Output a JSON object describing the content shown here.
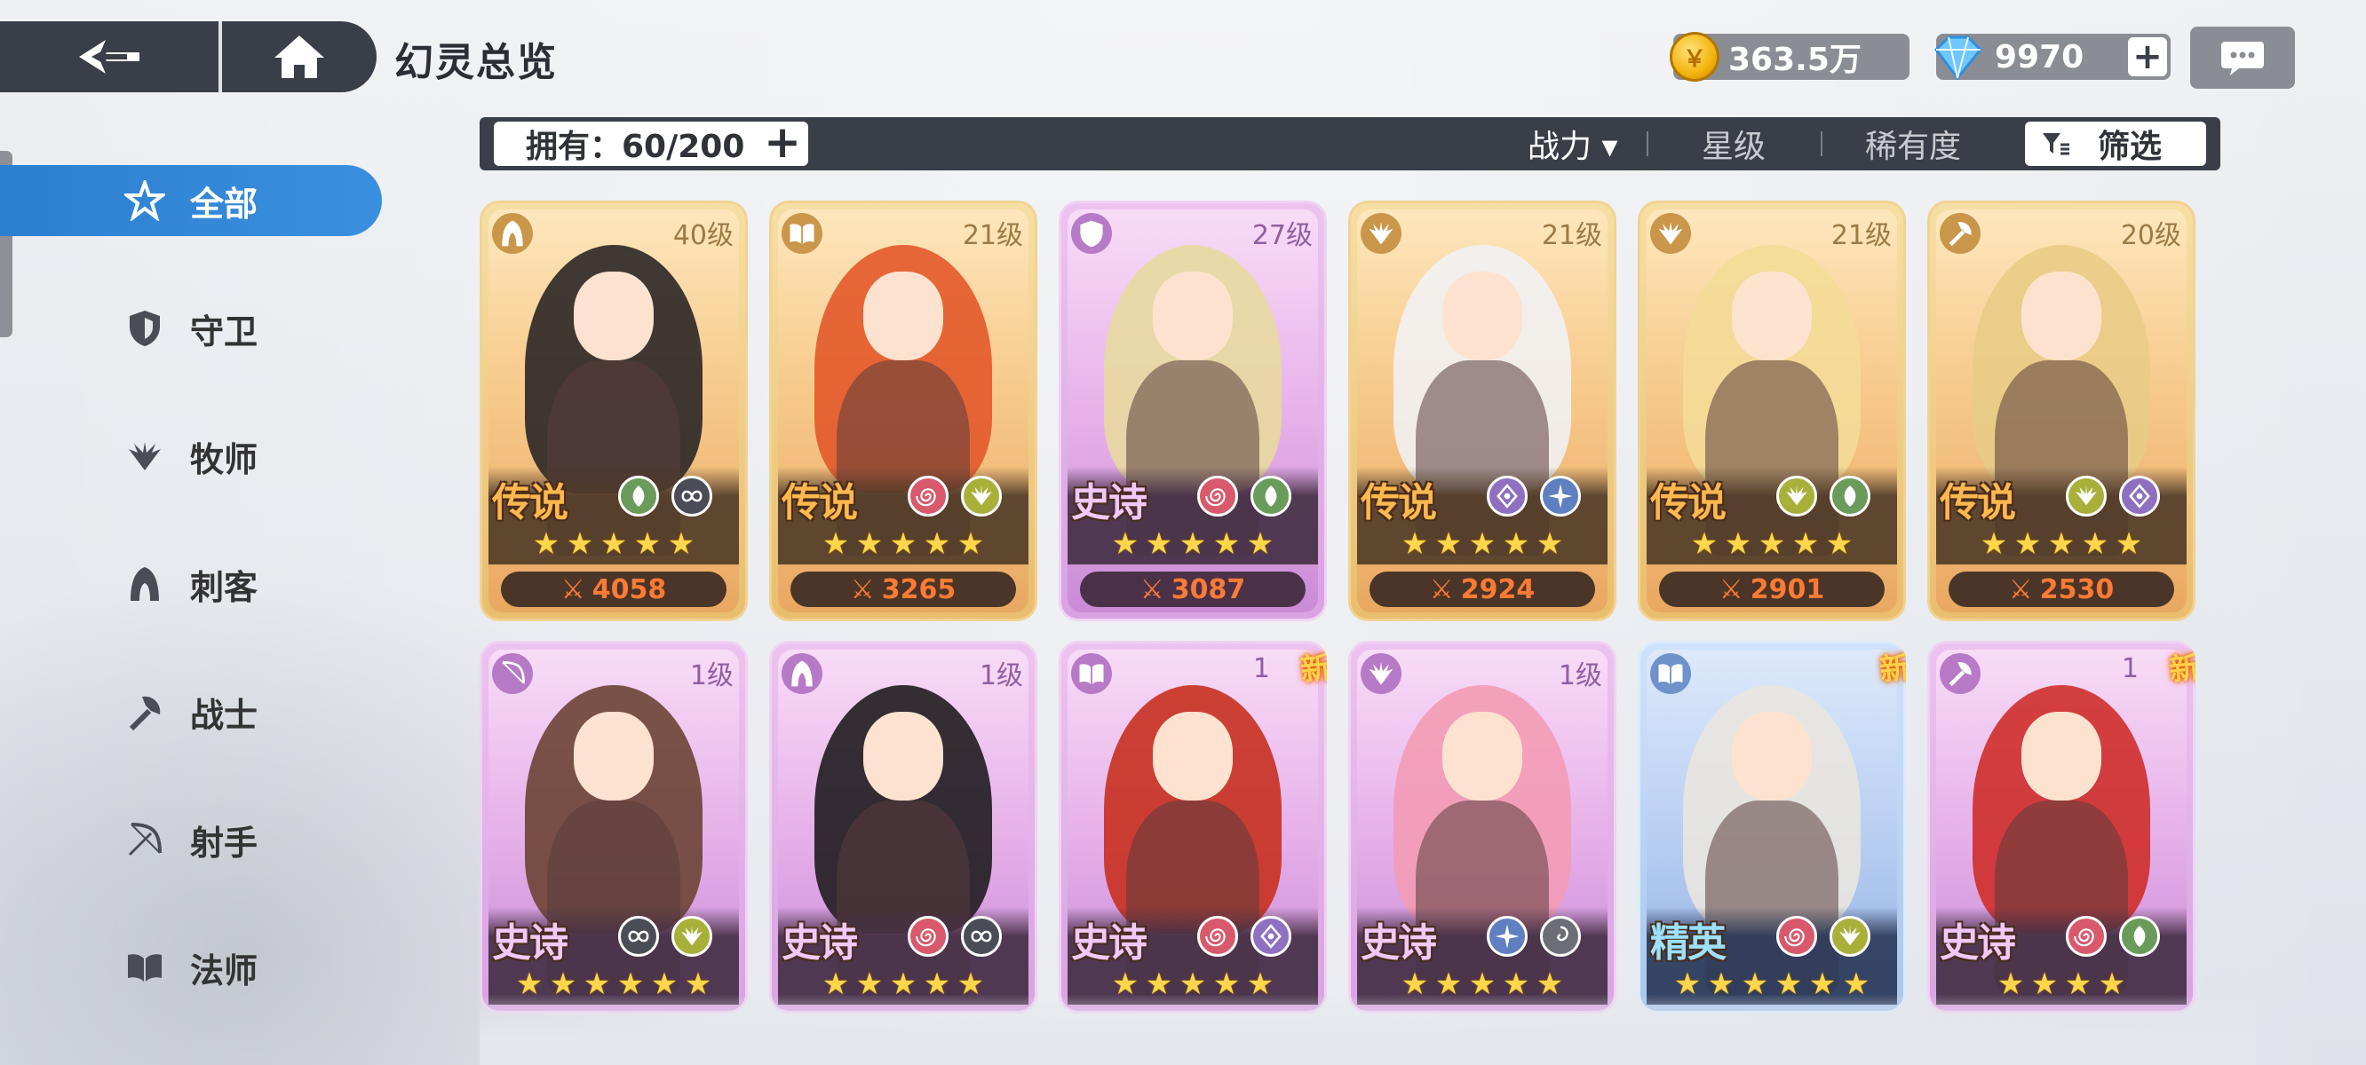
{
  "header": {
    "title": "幻灵总览"
  },
  "resources": {
    "gold": "363.5万",
    "gems": "9970"
  },
  "sidebar": {
    "items": [
      {
        "label": "全部",
        "icon": "all-star-icon",
        "active": true
      },
      {
        "label": "守卫",
        "icon": "shield-icon"
      },
      {
        "label": "牧师",
        "icon": "wings-icon"
      },
      {
        "label": "刺客",
        "icon": "hood-icon"
      },
      {
        "label": "战士",
        "icon": "axe-icon"
      },
      {
        "label": "射手",
        "icon": "bow-icon"
      },
      {
        "label": "法师",
        "icon": "book-icon"
      }
    ]
  },
  "filter": {
    "owned": "拥有：60/200",
    "sort_power": "战力 ▾",
    "sort_star": "星级",
    "sort_rarity": "稀有度",
    "filter_label": "筛选"
  },
  "cards": [
    {
      "level": "40级",
      "rarity": "传说",
      "stars": 5,
      "power": "4058",
      "class_icon": "hood-icon",
      "elements": [
        "leaf-icon",
        "infinity-icon"
      ],
      "theme": "legend",
      "hair": "#2b2626",
      "new": false
    },
    {
      "level": "21级",
      "rarity": "传说",
      "stars": 5,
      "power": "3265",
      "class_icon": "book-icon",
      "elements": [
        "spiral-icon",
        "wings-icon"
      ],
      "theme": "legend",
      "hair": "#e3592a",
      "new": false
    },
    {
      "level": "27级",
      "rarity": "史诗",
      "stars": 5,
      "power": "3087",
      "class_icon": "shield-icon",
      "elements": [
        "spiral-icon",
        "leaf-icon"
      ],
      "theme": "epic",
      "hair": "#e8d9a0",
      "new": false
    },
    {
      "level": "21级",
      "rarity": "传说",
      "stars": 5,
      "power": "2924",
      "class_icon": "wings-icon",
      "elements": [
        "diamond-icon",
        "sparkle-icon"
      ],
      "theme": "legend",
      "hair": "#f1f1f3",
      "new": false
    },
    {
      "level": "21级",
      "rarity": "传说",
      "stars": 5,
      "power": "2901",
      "class_icon": "wings-icon",
      "elements": [
        "wings-icon",
        "leaf-icon"
      ],
      "theme": "legend",
      "hair": "#f3dc97",
      "new": false
    },
    {
      "level": "20级",
      "rarity": "传说",
      "stars": 5,
      "power": "2530",
      "class_icon": "axe-icon",
      "elements": [
        "wings-icon",
        "diamond-icon"
      ],
      "theme": "legend",
      "hair": "#e8cc86",
      "new": false
    },
    {
      "level": "1级",
      "rarity": "史诗",
      "stars": 6,
      "power": "",
      "class_icon": "bow-icon",
      "elements": [
        "infinity-icon",
        "wings-icon"
      ],
      "theme": "epic",
      "hair": "#6b4434",
      "new": false
    },
    {
      "level": "1级",
      "rarity": "史诗",
      "stars": 5,
      "power": "",
      "class_icon": "hood-icon",
      "elements": [
        "spiral-icon",
        "infinity-icon"
      ],
      "theme": "epic",
      "hair": "#1f1c1f",
      "new": false
    },
    {
      "level": "1",
      "rarity": "史诗",
      "stars": 5,
      "power": "",
      "class_icon": "book-icon",
      "elements": [
        "spiral-icon",
        "diamond-icon"
      ],
      "theme": "epic",
      "hair": "#c8301f",
      "new": true,
      "new_label": "新"
    },
    {
      "level": "1级",
      "rarity": "史诗",
      "stars": 5,
      "power": "",
      "class_icon": "wings-icon",
      "elements": [
        "sparkle-icon",
        "swirl-icon"
      ],
      "theme": "epic",
      "hair": "#f39bb5",
      "new": false
    },
    {
      "level": "",
      "rarity": "精英",
      "stars": 6,
      "power": "",
      "class_icon": "book-icon",
      "elements": [
        "spiral-icon",
        "wings-icon"
      ],
      "theme": "elite",
      "hair": "#e9e6df",
      "new": true,
      "new_label": "新"
    },
    {
      "level": "1",
      "rarity": "史诗",
      "stars": 4,
      "power": "",
      "class_icon": "axe-icon",
      "elements": [
        "spiral-icon",
        "leaf-icon"
      ],
      "theme": "epic",
      "hair": "#cf2d2a",
      "new": true,
      "new_label": "新"
    }
  ]
}
